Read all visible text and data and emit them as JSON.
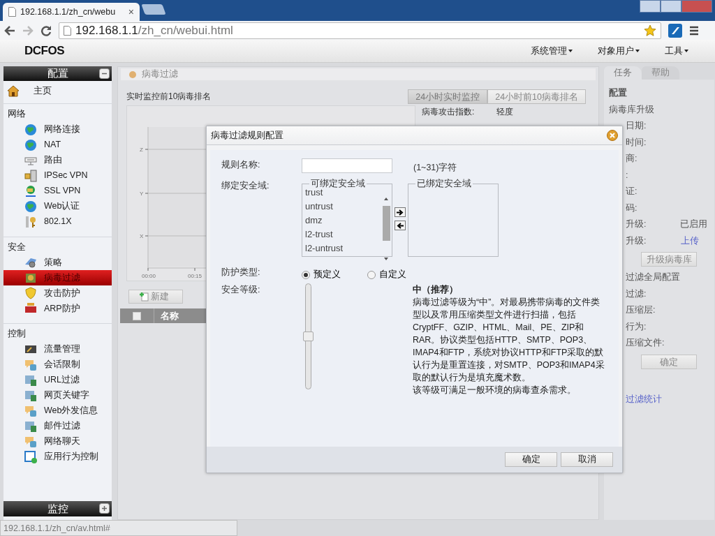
{
  "browser": {
    "tab_title": "192.168.1.1/zh_cn/webu",
    "tab_close": "×",
    "url_host": "192.168.1.1",
    "url_path": "/zh_cn/webui.html",
    "status_url": "192.168.1.1/zh_cn/av.html#"
  },
  "app": {
    "logo": "DCFOS",
    "menus": [
      {
        "label": "系统管理"
      },
      {
        "label": "对象用户"
      },
      {
        "label": "工具"
      }
    ]
  },
  "sidebar": {
    "panel_title": "配置",
    "expanded": true,
    "home": {
      "label": "主页",
      "selected": false
    },
    "sections": [
      {
        "title": "网络",
        "items": [
          {
            "label": "网络连接",
            "selected": false
          },
          {
            "label": "NAT",
            "selected": false
          },
          {
            "label": "路由",
            "selected": false
          },
          {
            "label": "IPSec VPN",
            "selected": false
          },
          {
            "label": "SSL VPN",
            "selected": false
          },
          {
            "label": "Web认证",
            "selected": false
          },
          {
            "label": "802.1X",
            "selected": false
          }
        ]
      },
      {
        "title": "安全",
        "items": [
          {
            "label": "策略",
            "selected": false
          },
          {
            "label": "病毒过滤",
            "selected": true
          },
          {
            "label": "攻击防护",
            "selected": false
          },
          {
            "label": "ARP防护",
            "selected": false
          }
        ]
      },
      {
        "title": "控制",
        "items": [
          {
            "label": "流量管理",
            "selected": false
          },
          {
            "label": "会话限制",
            "selected": false
          },
          {
            "label": "URL过滤",
            "selected": false
          },
          {
            "label": "网页关键字",
            "selected": false
          },
          {
            "label": "Web外发信息",
            "selected": false
          },
          {
            "label": "邮件过滤",
            "selected": false
          },
          {
            "label": "网络聊天",
            "selected": false
          },
          {
            "label": "应用行为控制",
            "selected": false
          }
        ]
      }
    ],
    "footer_panel": {
      "title": "监控",
      "expanded": false
    }
  },
  "main": {
    "breadcrumb": "病毒过滤",
    "section_title": "实时监控前10病毒排名",
    "view_buttons": [
      {
        "label": "24小时实时监控",
        "selected": true
      },
      {
        "label": "24小时前10病毒排名",
        "selected": false
      }
    ],
    "attack_index": {
      "label": "病毒攻击指数:",
      "value": "轻度"
    },
    "chart": {
      "y_labels": [
        "Z",
        "Y",
        "X"
      ],
      "x_labels": [
        "00:00",
        "00:15"
      ]
    },
    "toolbar": [
      {
        "label": "新建"
      }
    ],
    "table": {
      "columns": [
        "名称"
      ],
      "select_all_checked": false
    }
  },
  "dialog": {
    "title": "病毒过滤规则配置",
    "name_label": "规则名称:",
    "name_hint": "(1~31)字符",
    "zone_label": "绑定安全域:",
    "available_title": "可绑定安全域",
    "available_zones": [
      "trust",
      "untrust",
      "dmz",
      "l2-trust",
      "l2-untrust"
    ],
    "bound_title": "已绑定安全域",
    "type_label": "防护类型:",
    "types": [
      {
        "label": "预定义",
        "selected": true
      },
      {
        "label": "自定义",
        "selected": false
      }
    ],
    "level_label": "安全等级:",
    "security": {
      "level": 0.5
    },
    "level_title": "中（推荐）",
    "description": "病毒过滤等级为“中”。对最易携带病毒的文件类型以及常用压缩类型文件进行扫描，包括CryptFF、GZIP、HTML、Mail、PE、ZIP和RAR。协议类型包括HTTP、SMTP、POP3、IMAP4和FTP，系统对协议HTTP和FTP采取的默认行为是重置连接，对SMTP、POP3和IMAP4采取的默认行为是填充魔术数。",
    "note": "该等级可满足一般环境的病毒查杀需求。",
    "buttons": [
      {
        "label": "确定"
      },
      {
        "label": "取消"
      }
    ]
  },
  "right_panel": {
    "tabs": [
      {
        "label": "任务",
        "selected": true
      },
      {
        "label": "帮助",
        "selected": false
      }
    ],
    "lines": [
      {
        "kind": "heading",
        "text": "配置"
      },
      {
        "kind": "text",
        "text": "病毒库升级"
      },
      {
        "kind": "field",
        "text": "日期:"
      },
      {
        "kind": "field",
        "text": "时间:"
      },
      {
        "kind": "field",
        "text": "商:"
      },
      {
        "kind": "field",
        "text": ":"
      },
      {
        "kind": "field",
        "text": "证:"
      },
      {
        "kind": "field",
        "text": "码:"
      },
      {
        "kind": "field",
        "text": "升级:",
        "value": "已启用"
      },
      {
        "kind": "field",
        "text": "升级:",
        "link": "上传"
      },
      {
        "kind": "button",
        "text": "升级病毒库"
      },
      {
        "kind": "field",
        "text": "过滤全局配置"
      },
      {
        "kind": "field",
        "text": "过滤:"
      },
      {
        "kind": "field",
        "text": "压缩层:"
      },
      {
        "kind": "field",
        "text": "行为:"
      },
      {
        "kind": "field",
        "text": "压缩文件:"
      },
      {
        "kind": "button",
        "text": "确定"
      },
      {
        "kind": "link",
        "text": "过滤统计"
      }
    ]
  }
}
